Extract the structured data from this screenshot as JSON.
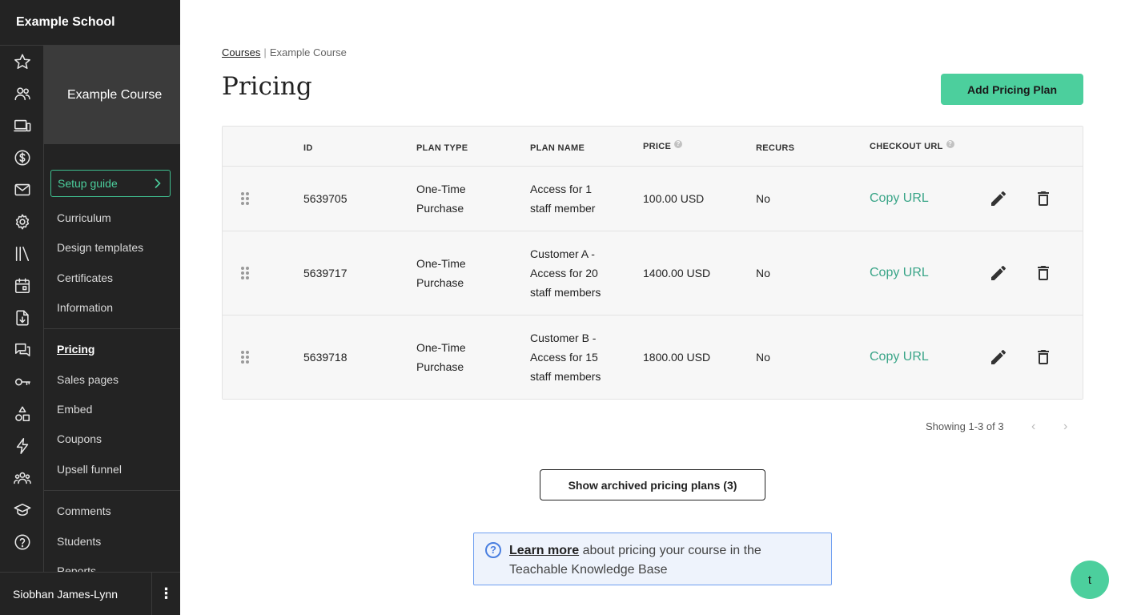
{
  "sidebar": {
    "school_name": "Example School",
    "course_name": "Example Course",
    "setup_guide": "Setup guide",
    "nav_group_1": [
      "Curriculum",
      "Design templates",
      "Certificates",
      "Information"
    ],
    "nav_group_2": [
      "Pricing",
      "Sales pages",
      "Embed",
      "Coupons",
      "Upsell funnel"
    ],
    "nav_group_3": [
      "Comments",
      "Students",
      "Reports"
    ],
    "active_item": "Pricing",
    "user_name": "Siobhan James-Lynn",
    "user_menu_icon": "⋮",
    "rail_icons": [
      "star-icon",
      "users-icon",
      "devices-icon",
      "dollar-icon",
      "mail-icon",
      "gear-icon",
      "library-icon",
      "calendar-icon",
      "download-icon",
      "comments-icon",
      "key-icon",
      "shapes-icon",
      "lightning-icon",
      "group-icon",
      "graduation-icon",
      "help-icon"
    ]
  },
  "breadcrumb": {
    "root": "Courses",
    "separator": "|",
    "current": "Example Course"
  },
  "page": {
    "title": "Pricing",
    "add_button": "Add Pricing Plan"
  },
  "table": {
    "headers": {
      "id": "ID",
      "plan_type": "PLAN TYPE",
      "plan_name": "PLAN NAME",
      "price": "PRICE",
      "recurs": "RECURS",
      "checkout_url": "CHECKOUT URL",
      "help_glyph": "?"
    },
    "rows": [
      {
        "id": "5639705",
        "plan_type_1": "One-Time",
        "plan_type_2": "Purchase",
        "plan_name_1": "Access for 1",
        "plan_name_2": "staff member",
        "plan_name_3": "",
        "price": "100.00 USD",
        "recurs": "No",
        "checkout": "Copy URL"
      },
      {
        "id": "5639717",
        "plan_type_1": "One-Time",
        "plan_type_2": "Purchase",
        "plan_name_1": "Customer A -",
        "plan_name_2": "Access for 20",
        "plan_name_3": "staff members",
        "price": "1400.00 USD",
        "recurs": "No",
        "checkout": "Copy URL"
      },
      {
        "id": "5639718",
        "plan_type_1": "One-Time",
        "plan_type_2": "Purchase",
        "plan_name_1": "Customer B -",
        "plan_name_2": "Access for 15",
        "plan_name_3": "staff members",
        "price": "1800.00 USD",
        "recurs": "No",
        "checkout": "Copy URL"
      }
    ]
  },
  "pagination": {
    "text": "Showing 1-3 of 3",
    "prev": "‹",
    "next": "›"
  },
  "archived_button": "Show archived pricing plans (3)",
  "info": {
    "icon_glyph": "?",
    "link": "Learn more",
    "text": " about pricing your course in the Teachable Knowledge Base"
  },
  "chat_bubble": {
    "glyph": "t"
  },
  "colors": {
    "accent": "#4ccf9d",
    "sidebar_bg": "#232323",
    "link_green": "#3aa588",
    "info_border": "#6e9ef0"
  }
}
